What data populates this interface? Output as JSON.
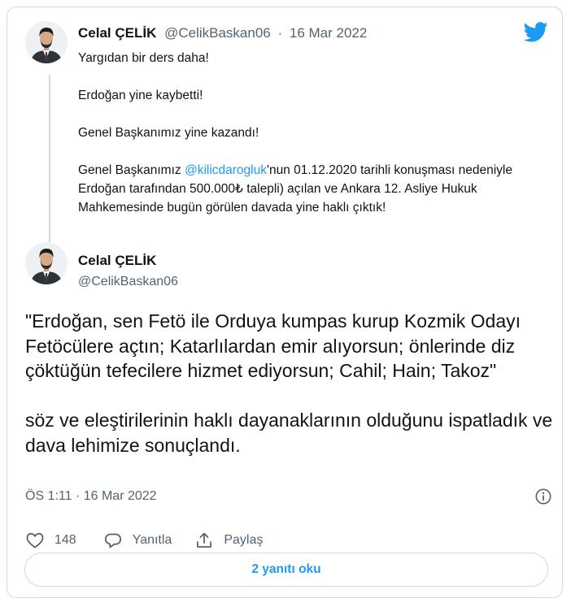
{
  "parent_tweet": {
    "author_name": "Celal ÇELİK",
    "author_handle": "@CelikBaskan06",
    "separator": "·",
    "date": "16 Mar 2022",
    "line1": "Yargıdan bir ders daha!",
    "line2": "Erdoğan yine kaybetti!",
    "line3": "Genel Başkanımız yine kazandı!",
    "line4_before": "Genel Başkanımız ",
    "line4_mention": "@kilicdarogluk",
    "line4_after": "'nun 01.12.2020 tarihli konuşması nedeniyle Erdoğan tarafından 500.000₺ talepli) açılan ve Ankara 12. Asliye Hukuk Mahkemesinde bugün görülen davada yine haklı çıktık!"
  },
  "main_tweet": {
    "author_name": "Celal ÇELİK",
    "author_handle": "@CelikBaskan06",
    "paragraph1": "\"Erdoğan, sen Fetö ile Orduya kumpas kurup Kozmik Odayı Fetöcülere açtın; Katarlılardan  emir alıyorsun; önlerinde diz çöktüğün tefecilere hizmet ediyorsun; Cahil; Hain; Takoz\"",
    "paragraph2": "söz ve eleştirilerinin haklı dayanaklarının olduğunu ispatladık ve dava lehimize sonuçlandı.",
    "timestamp": "ÖS 1:11 · 16 Mar 2022"
  },
  "actions": {
    "like_count": "148",
    "reply_label": "Yanıtla",
    "share_label": "Paylaş"
  },
  "read_replies_label": "2 yanıtı oku",
  "colors": {
    "accent": "#1d9bf0",
    "text": "#0f1419",
    "secondary": "#536471",
    "border": "#cfd9de"
  },
  "icons": [
    "twitter-logo-icon",
    "info-icon",
    "heart-icon",
    "reply-icon",
    "share-icon"
  ]
}
